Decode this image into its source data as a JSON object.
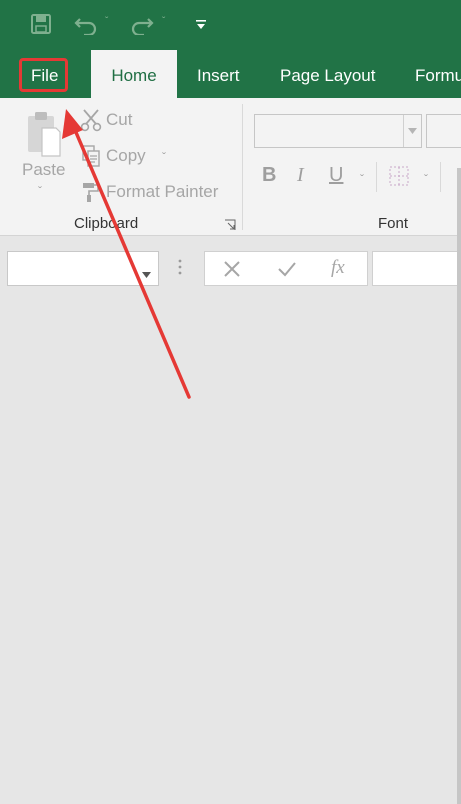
{
  "colors": {
    "title_bar": "#217346",
    "ribbon": "#f3f3f3",
    "sheet_background": "#e6e6e6",
    "highlight": "#e53935",
    "disabled_text": "#a6a6a6"
  },
  "quick_access": {
    "icons": [
      "save-icon",
      "undo-icon",
      "redo-icon",
      "customize-qat-icon"
    ]
  },
  "tabs": [
    {
      "label": "File",
      "highlighted": true
    },
    {
      "label": "Home",
      "active": true
    },
    {
      "label": "Insert"
    },
    {
      "label": "Page Layout"
    },
    {
      "label": "Formu"
    }
  ],
  "clipboard": {
    "paste_label": "Paste",
    "cut_label": "Cut",
    "copy_label": "Copy",
    "format_painter_label": "Format Painter",
    "group_label": "Clipboard"
  },
  "font": {
    "bold_label": "B",
    "italic_label": "I",
    "underline_label": "U",
    "group_label": "Font"
  },
  "formula_bar": {
    "fx_label": "fx",
    "name_box_value": "",
    "formula_value": ""
  }
}
